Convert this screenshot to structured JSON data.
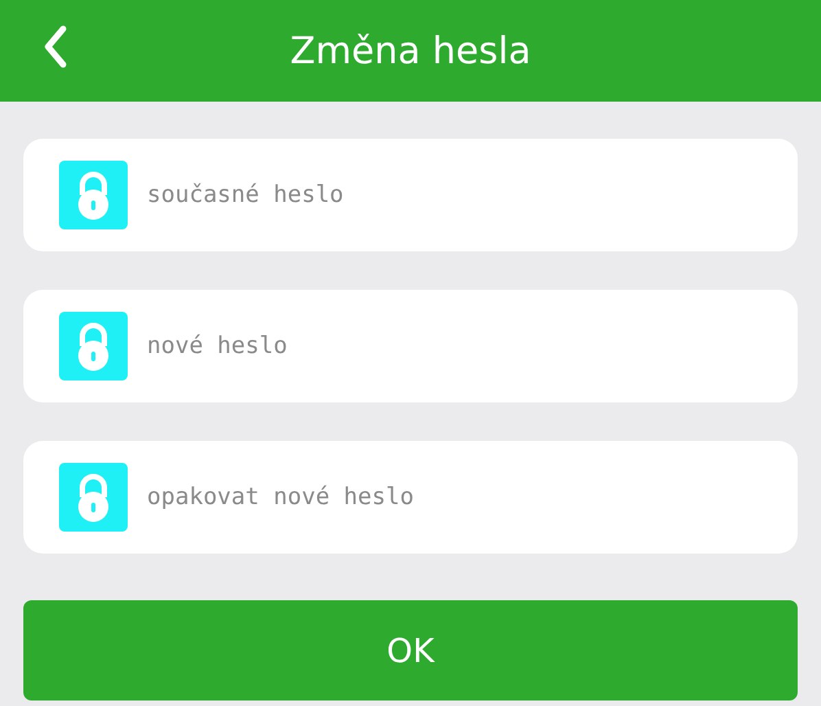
{
  "header": {
    "title": "Změna hesla"
  },
  "fields": [
    {
      "placeholder": "současné heslo"
    },
    {
      "placeholder": "nové heslo"
    },
    {
      "placeholder": "opakovat nové heslo"
    }
  ],
  "submit_button": {
    "label": "OK"
  }
}
